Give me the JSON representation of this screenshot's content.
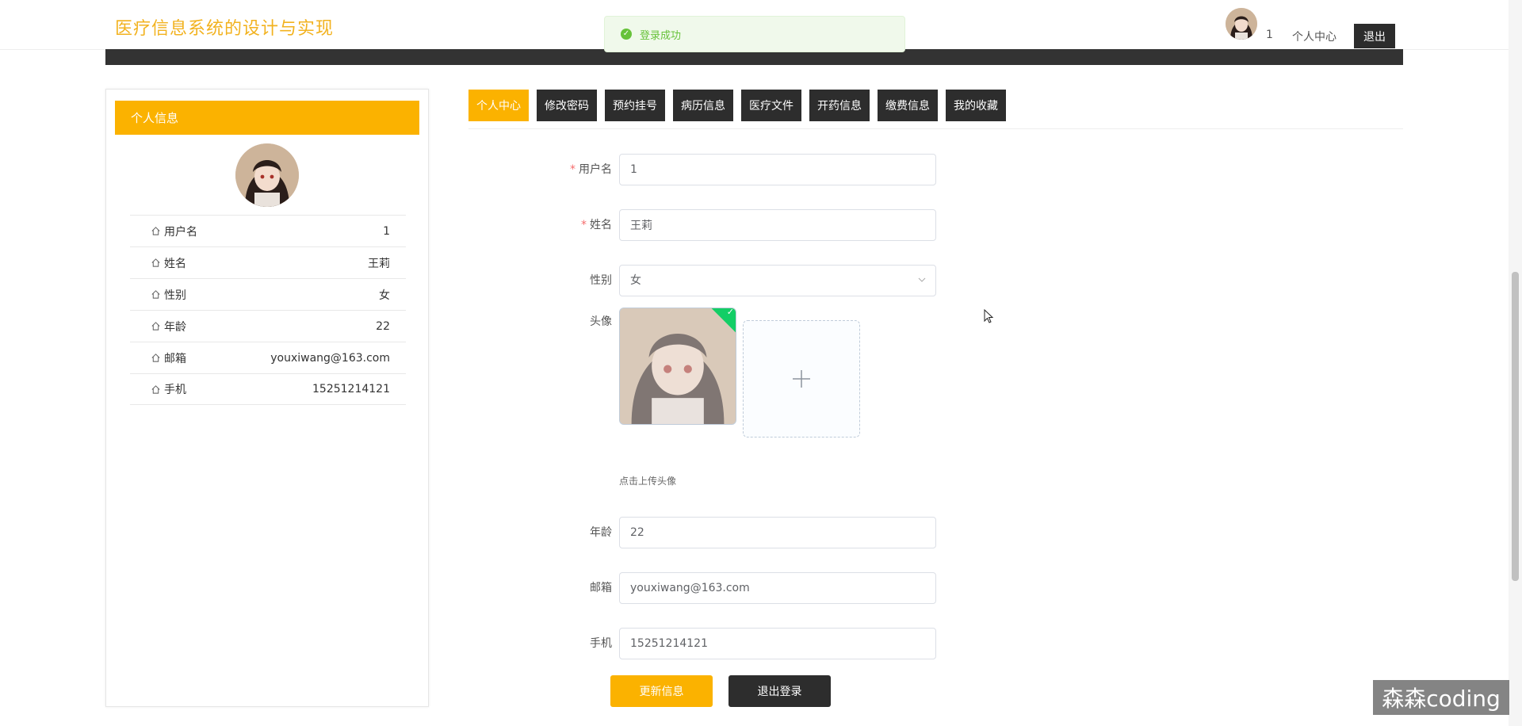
{
  "header": {
    "site_title": "医疗信息系统的设计与实现",
    "username": "1",
    "center_link": "个人中心",
    "logout_label": "退出"
  },
  "toast": {
    "message": "登录成功"
  },
  "profile_card": {
    "title": "个人信息",
    "rows": [
      {
        "label": "用户名",
        "value": "1"
      },
      {
        "label": "姓名",
        "value": "王莉"
      },
      {
        "label": "性别",
        "value": "女"
      },
      {
        "label": "年龄",
        "value": "22"
      },
      {
        "label": "邮箱",
        "value": "youxiwang@163.com"
      },
      {
        "label": "手机",
        "value": "15251214121"
      }
    ]
  },
  "tabs": [
    "个人中心",
    "修改密码",
    "预约挂号",
    "病历信息",
    "医疗文件",
    "开药信息",
    "缴费信息",
    "我的收藏"
  ],
  "form": {
    "username_label": "用户名",
    "username_value": "1",
    "name_label": "姓名",
    "name_value": "王莉",
    "gender_label": "性别",
    "gender_value": "女",
    "avatar_label": "头像",
    "avatar_hint": "点击上传头像",
    "age_label": "年龄",
    "age_value": "22",
    "email_label": "邮箱",
    "email_value": "youxiwang@163.com",
    "phone_label": "手机",
    "phone_value": "15251214121",
    "update_button": "更新信息",
    "logout_button": "退出登录"
  },
  "watermark": "森森coding",
  "colors": {
    "accent": "#fbb200",
    "dark": "#2d2d2d",
    "title": "#f2b21f",
    "success": "#67c23a"
  }
}
